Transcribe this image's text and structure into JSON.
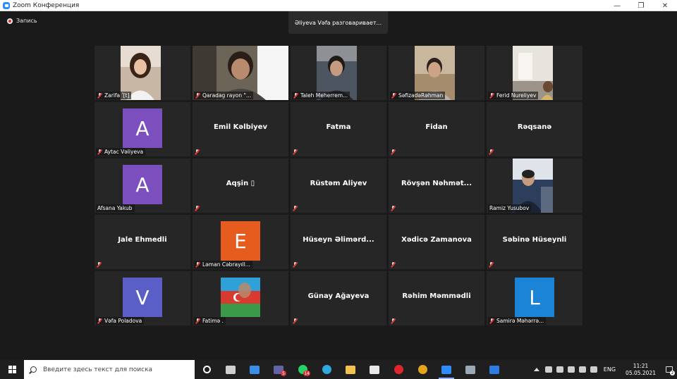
{
  "window": {
    "title": "Zoom Конференция",
    "controls": [
      "—",
      "❐",
      "✕"
    ]
  },
  "recording": {
    "label": "Запись"
  },
  "speaker": {
    "text": "Əliyeva Vəfa разговаривает..."
  },
  "tiles": [
    {
      "name": "Zarifa ʹ[t]",
      "kind": "photo",
      "photo": "girl"
    },
    {
      "name": "Qaradag rayon \"...",
      "kind": "photo",
      "photo": "man-wide"
    },
    {
      "name": "Taleh Meherrem...",
      "kind": "photo",
      "photo": "man-dark"
    },
    {
      "name": "SəfizadəRəhman",
      "kind": "photo",
      "photo": "man-room"
    },
    {
      "name": "Ferid Nureliyev",
      "kind": "photo",
      "photo": "room"
    },
    {
      "name": "Aytac Vəliyeva",
      "kind": "avatar",
      "letter": "A",
      "color": "#7c4fbf"
    },
    {
      "name": "Emil Kəlbiyev",
      "kind": "text"
    },
    {
      "name": "Fatma",
      "kind": "text"
    },
    {
      "name": "Fidan",
      "kind": "text"
    },
    {
      "name": "Rəqsanə",
      "kind": "text"
    },
    {
      "name": "Afsana Yakub",
      "kind": "avatar",
      "letter": "A",
      "color": "#7c4fbf",
      "unmuted": true
    },
    {
      "name": "Aqşin ▯",
      "kind": "text"
    },
    {
      "name": "Rüstəm Aliyev",
      "kind": "text"
    },
    {
      "name": "Rövşən  Nəhmət...",
      "kind": "text"
    },
    {
      "name": "Ramiz Yusubov",
      "kind": "photo",
      "photo": "suit",
      "unmuted": true
    },
    {
      "name": "Jale Ehmedli",
      "kind": "text"
    },
    {
      "name": "Ləman  Cəbrayıll...",
      "kind": "avatar",
      "letter": "E",
      "color": "#e65c1e"
    },
    {
      "name": "Hüseyn  Əlimərd...",
      "kind": "text"
    },
    {
      "name": "Xədicə Zamanova",
      "kind": "text"
    },
    {
      "name": "Səbinə Hüseynli",
      "kind": "text"
    },
    {
      "name": "Vəfa Poladova",
      "kind": "avatar",
      "letter": "V",
      "color": "#5a5fc7"
    },
    {
      "name": "Fatimə .",
      "kind": "photo",
      "photo": "flag"
    },
    {
      "name": "Günay Ağayeva",
      "kind": "text"
    },
    {
      "name": "Rəhim Məmmədli",
      "kind": "text"
    },
    {
      "name": "Samirə Məhərrə...",
      "kind": "avatar",
      "letter": "L",
      "color": "#1b84d6"
    }
  ],
  "taskbar": {
    "search_placeholder": "Введите здесь текст для поиска",
    "apps": [
      {
        "name": "task-view-icon",
        "color": "#ffffff"
      },
      {
        "name": "multitasking-icon",
        "color": "#cfcfcf"
      },
      {
        "name": "mail-icon",
        "color": "#3b8ee8"
      },
      {
        "name": "teams-icon",
        "color": "#6264a7",
        "badge": "5"
      },
      {
        "name": "whatsapp-icon",
        "color": "#25d366",
        "badge": "14"
      },
      {
        "name": "edge-icon",
        "color": "#2fa9e0"
      },
      {
        "name": "explorer-icon",
        "color": "#f2c14e"
      },
      {
        "name": "store-icon",
        "color": "#e8e8e8"
      },
      {
        "name": "opera-icon",
        "color": "#e0262c"
      },
      {
        "name": "chrome-icon",
        "color": "#e4a51c"
      },
      {
        "name": "zoom-icon",
        "color": "#2d8cff",
        "active": true
      },
      {
        "name": "app-icon",
        "color": "#9aa9b8"
      },
      {
        "name": "bluetooth-icon",
        "color": "#2d7de0"
      }
    ],
    "tray": {
      "language": "ENG",
      "time": "11:21",
      "date": "05.05.2021",
      "notifications": "2"
    }
  }
}
